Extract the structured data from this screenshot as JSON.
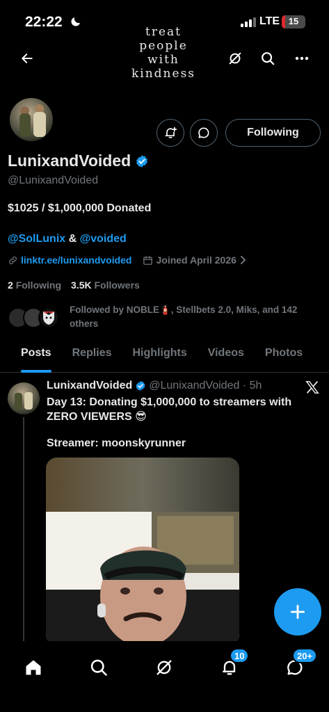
{
  "status_bar": {
    "time": "22:22",
    "network": "LTE",
    "battery": "15",
    "battery_level": 0.15
  },
  "banner": {
    "lines": [
      "treat",
      "people",
      "with",
      "kindness"
    ]
  },
  "profile": {
    "display_name": "LunixandVoided",
    "handle": "@LunixandVoided",
    "bio_line1": "$1025 / $1,000,000 Donated",
    "bio_mention1": "@SolLunix",
    "bio_amp": " & ",
    "bio_mention2": "@voided",
    "link": "linktr.ee/lunixandvoided",
    "joined": "Joined April 2026",
    "following_count": "2",
    "following_label": "Following",
    "followers_count": "3.5K",
    "followers_label": "Followers",
    "follow_button": "Following",
    "followed_by": "Followed by NOBLE🧯, Stellbets 2.0, Miks, and 142 others"
  },
  "tabs": [
    {
      "label": "Posts",
      "active": true
    },
    {
      "label": "Replies",
      "active": false
    },
    {
      "label": "Highlights",
      "active": false
    },
    {
      "label": "Videos",
      "active": false
    },
    {
      "label": "Photos",
      "active": false
    }
  ],
  "post": {
    "author": "LunixandVoided",
    "handle_time": "@LunixandVoided · 5h",
    "text": "Day 13: Donating $1,000,000 to streamers with ZERO VIEWERS 😎",
    "text2": "Streamer: moonskyrunner"
  },
  "bottom_nav": {
    "notifications_badge": "10",
    "messages_badge": "20+"
  },
  "colors": {
    "accent": "#1d9bf0",
    "background": "#000000",
    "text": "#e7e9ea",
    "muted": "#71767b"
  }
}
